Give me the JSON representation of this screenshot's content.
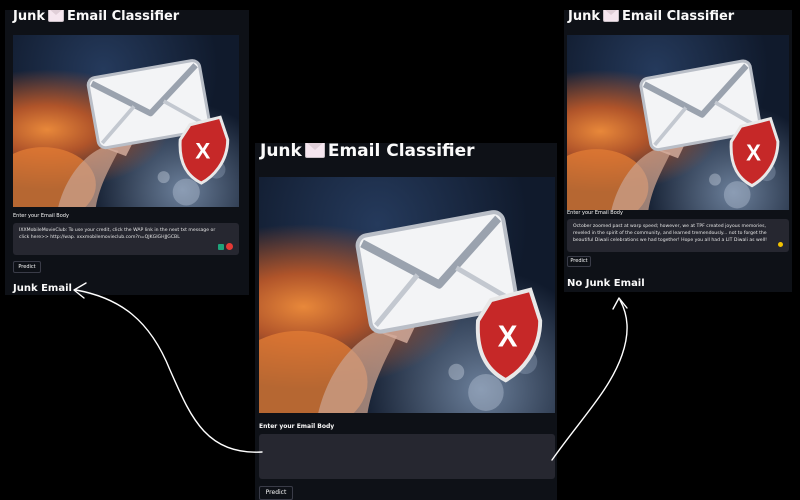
{
  "app": {
    "title_prefix": "Junk",
    "title_suffix": "Email Classifier",
    "title_icon": "love-letter-icon"
  },
  "panels": {
    "left": {
      "input_label": "Enter your Email Body",
      "email_body": "IXXMobileMovieClub: To use your credit, click the WAP link in the next txt message or click here>> http://wap. xxxmobilemovieclub.com?n=QJKGIGHJJGCBL",
      "predict_label": "Predict",
      "result": "Junk Email"
    },
    "center": {
      "input_label": "Enter your Email Body",
      "email_body": "",
      "predict_label": "Predict"
    },
    "right": {
      "input_label": "Enter your Email Body",
      "email_body": "October zoomed past at warp speed; however, we at TPF created joyous memories, reveled in the spirit of the community, and learned tremendously... not to forget the beautiful Diwali celebrations we had together! Hope you all had a LIT Diwali as well!",
      "predict_label": "Predict",
      "result": "No Junk Email"
    }
  },
  "colors": {
    "page_background": "#000000",
    "panel_background": "#0e1117",
    "input_background": "#262730",
    "text": "#fafafa"
  }
}
